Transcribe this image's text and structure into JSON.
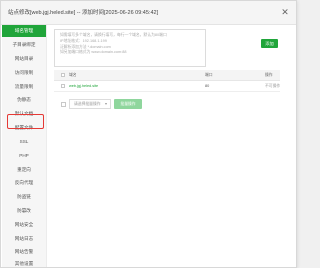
{
  "dialog": {
    "title": "站点修改[web.jgj.heled.site] -- 添加时间[2025-06-26 09:45:42]",
    "close_label": "✕"
  },
  "sidebar": {
    "active_index": 0,
    "items": [
      {
        "label": "域名管理"
      },
      {
        "label": "子目录绑定"
      },
      {
        "label": "网站目录"
      },
      {
        "label": "访问限制"
      },
      {
        "label": "流量限制"
      },
      {
        "label": "伪静态"
      },
      {
        "label": "默认文档"
      },
      {
        "label": "配置文件"
      },
      {
        "label": "SSL"
      },
      {
        "label": "PHP"
      },
      {
        "label": "重定向"
      },
      {
        "label": "反向代理"
      },
      {
        "label": "防盗链"
      },
      {
        "label": "防篡改"
      },
      {
        "label": "网站安全"
      },
      {
        "label": "网站日志"
      },
      {
        "label": "网站告警"
      },
      {
        "label": "其他设置"
      }
    ]
  },
  "domain_input": {
    "placeholder_lines": [
      "如需填写多个域名，请换行填写，每行一个域名，默认为80端口",
      "IP地址格式：192.168.1.199",
      "泛解析添加方法 *.domain.com",
      "如另加端口格式为 www.domain.com:88"
    ]
  },
  "add_button": {
    "label": "添加"
  },
  "table": {
    "headers": {
      "domain": "域名",
      "port": "端口",
      "action": "操作"
    },
    "rows": [
      {
        "domain": "web.jgj.heled.site",
        "port": "80",
        "action": "不可操作"
      }
    ]
  },
  "batch": {
    "select_placeholder": "请选择批量操作",
    "button_label": "批量操作"
  },
  "colors": {
    "accent": "#20a53a",
    "link": "#20a53a",
    "highlight_border": "#e53935"
  }
}
